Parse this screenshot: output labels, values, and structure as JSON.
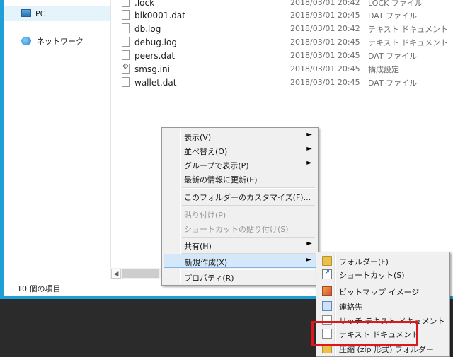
{
  "nav": {
    "items": [
      {
        "label": "PC",
        "icon": "pc-icon"
      },
      {
        "label": "ネットワーク",
        "icon": "network-icon"
      }
    ]
  },
  "files": [
    {
      "name": ".lock",
      "date": "2018/03/01 20:42",
      "type": "LOCK ファイル",
      "icon": "file-icon"
    },
    {
      "name": "blk0001.dat",
      "date": "2018/03/01 20:45",
      "type": "DAT ファイル",
      "icon": "file-icon"
    },
    {
      "name": "db.log",
      "date": "2018/03/01 20:42",
      "type": "テキスト ドキュメント",
      "icon": "file-icon"
    },
    {
      "name": "debug.log",
      "date": "2018/03/01 20:45",
      "type": "テキスト ドキュメント",
      "icon": "file-icon"
    },
    {
      "name": "peers.dat",
      "date": "2018/03/01 20:45",
      "type": "DAT ファイル",
      "icon": "file-icon"
    },
    {
      "name": "smsg.ini",
      "date": "2018/03/01 20:45",
      "type": "構成設定",
      "icon": "settings-file-icon"
    },
    {
      "name": "wallet.dat",
      "date": "2018/03/01 20:45",
      "type": "DAT ファイル",
      "icon": "file-icon"
    }
  ],
  "status": {
    "item_count": "10 個の項目"
  },
  "context_menu": {
    "items": [
      {
        "label": "表示(V)",
        "submenu": true
      },
      {
        "label": "並べ替え(O)",
        "submenu": true
      },
      {
        "label": "グループで表示(P)",
        "submenu": true
      },
      {
        "label": "最新の情報に更新(E)"
      },
      {
        "label": "このフォルダーのカスタマイズ(F)..."
      },
      {
        "label": "貼り付け(P)",
        "disabled": true
      },
      {
        "label": "ショートカットの貼り付け(S)",
        "disabled": true
      },
      {
        "label": "共有(H)",
        "submenu": true
      },
      {
        "label": "新規作成(X)",
        "submenu": true,
        "highlighted": true
      },
      {
        "label": "プロパティ(R)"
      }
    ]
  },
  "new_submenu": {
    "items": [
      {
        "label": "フォルダー(F)",
        "icon": "folder-icon"
      },
      {
        "label": "ショートカット(S)",
        "icon": "shortcut-icon"
      },
      {
        "label": "ビットマップ イメージ",
        "icon": "bitmap-icon"
      },
      {
        "label": "連絡先",
        "icon": "contact-icon"
      },
      {
        "label": "リッチ テキスト ドキュメント",
        "icon": "rtf-icon"
      },
      {
        "label": "テキスト ドキュメント",
        "icon": "text-document-icon"
      },
      {
        "label": "圧縮 (zip 形式) フォルダー",
        "icon": "zip-folder-icon"
      }
    ]
  },
  "colors": {
    "highlight_box": "#e0161f",
    "window_frame": "#1e9fd6"
  }
}
